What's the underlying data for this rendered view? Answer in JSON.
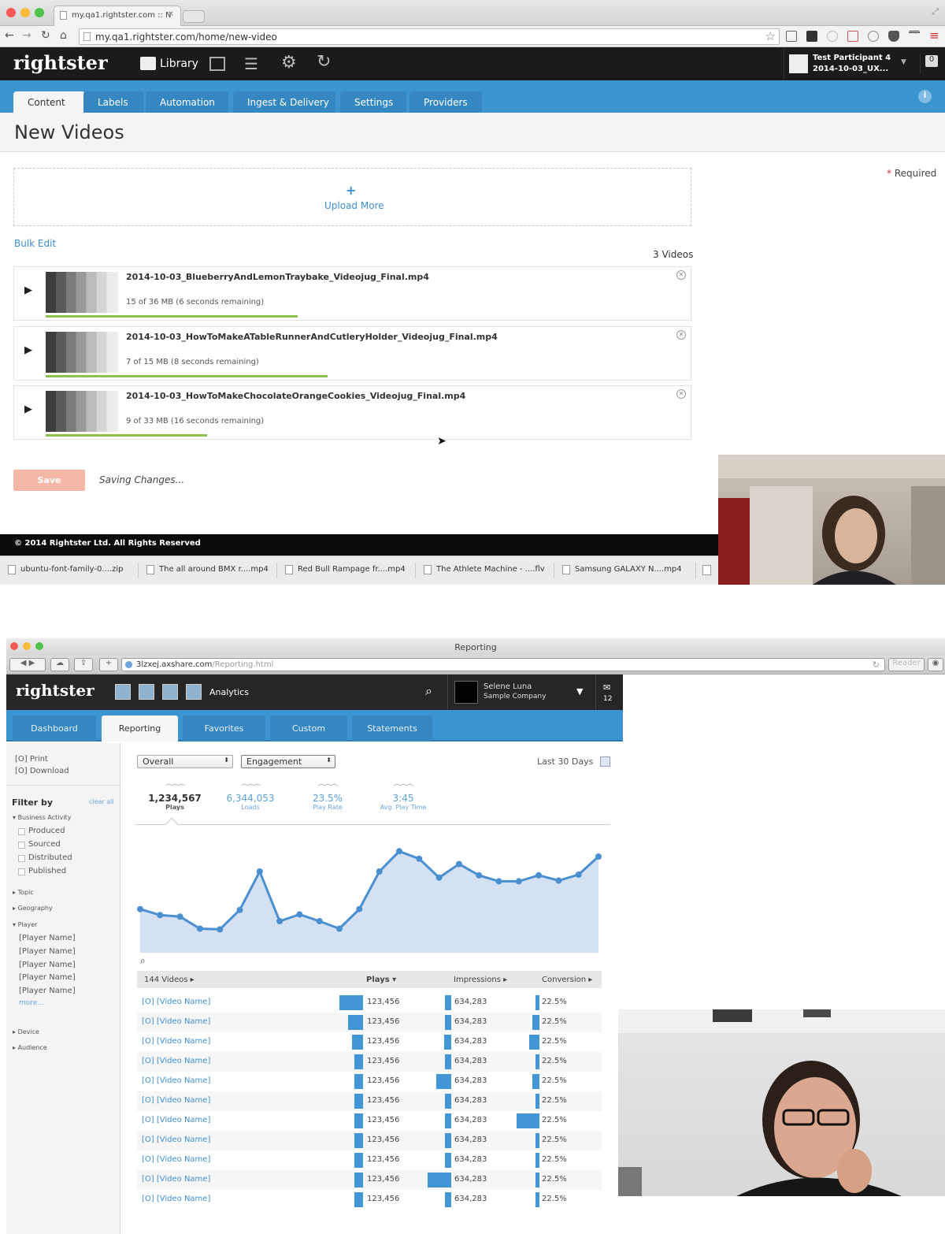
{
  "top_session": {
    "browser": {
      "tab_title": "my.qa1.rightster.com :: N",
      "url": "my.qa1.rightster.com/home/new-video"
    },
    "app": {
      "logo": "rightster",
      "library_label": "Library",
      "user_name": "Test Participant 4",
      "user_sub": "2014-10-03_UX...",
      "notif_count": "0",
      "tabs": [
        "Content",
        "Labels",
        "Automation",
        "Ingest & Delivery",
        "Settings",
        "Providers"
      ],
      "active_tab": "Content"
    },
    "page": {
      "title": "New Videos",
      "required_note": "Required",
      "upload_more": "Upload More",
      "bulk_edit": "Bulk Edit",
      "video_count": "3 Videos",
      "videos": [
        {
          "name": "2014-10-03_BlueberryAndLemonTraybake_Videojug_Final.mp4",
          "progress_text": "15 of 36 MB (6 seconds remaining)",
          "progress": 0.42
        },
        {
          "name": "2014-10-03_HowToMakeATableRunnerAndCutleryHolder_Videojug_Final.mp4",
          "progress_text": "7 of 15 MB (8 seconds remaining)",
          "progress": 0.47
        },
        {
          "name": "2014-10-03_HowToMakeChocolateOrangeCookies_Videojug_Final.mp4",
          "progress_text": "9 of 33 MB (16 seconds remaining)",
          "progress": 0.27
        }
      ],
      "save_label": "Save",
      "saving_text": "Saving Changes...",
      "footer": "© 2014 Rightster Ltd. All Rights Reserved"
    },
    "downloads": [
      "ubuntu-font-family-0....zip",
      "The all around BMX r....mp4",
      "Red Bull Rampage fr....mp4",
      "The Athlete Machine - ....flv",
      "Samsung GALAXY N....mp4"
    ]
  },
  "bottom_session": {
    "window_title": "Reporting",
    "url_host": "3lzxej.axshare.com",
    "url_path": "/Reporting.html",
    "reader_label": "Reader",
    "app": {
      "logo": "rightster",
      "section": "Analytics",
      "user_name": "Selene Luna",
      "company": "Sample Company",
      "msg_count": "12",
      "tabs": [
        "Dashboard",
        "Reporting",
        "Favorites",
        "Custom",
        "Statements"
      ],
      "active_tab": "Reporting"
    },
    "sidebar": {
      "print": "[O] Print",
      "download": "[O] Download",
      "filter_by": "Filter by",
      "clear_all": "clear all",
      "business_activity": "Business Activity",
      "business_items": [
        "Produced",
        "Sourced",
        "Distributed",
        "Published"
      ],
      "topic": "Topic",
      "geography": "Geography",
      "player": "Player",
      "player_items": [
        "[Player Name]",
        "[Player Name]",
        "[Player Name]",
        "[Player Name]",
        "[Player Name]"
      ],
      "more": "more...",
      "device": "Device",
      "audience": "Audience"
    },
    "controls": {
      "scope": "Overall",
      "metric": "Engagement",
      "range": "Last 30 Days"
    },
    "metrics": [
      {
        "value": "1,234,567",
        "label": "Plays"
      },
      {
        "value": "6,344,053",
        "label": "Loads"
      },
      {
        "value": "23.5%",
        "label": "Play Rate"
      },
      {
        "value": "3:45",
        "label": "Avg. Play Time"
      }
    ],
    "chart_data": {
      "type": "area",
      "title": "",
      "values": [
        58,
        50,
        48,
        32,
        31,
        57,
        108,
        42,
        51,
        42,
        32,
        58,
        108,
        135,
        125,
        100,
        118,
        103,
        95,
        95,
        103,
        96,
        104,
        128
      ],
      "ylim": [
        0,
        150
      ],
      "grid": false,
      "color": "#4a8fd0",
      "fill": "#d3e1f2"
    },
    "table": {
      "headers": [
        "144 Videos ▸",
        "Plays ▾",
        "Impressions ▸",
        "Conversion ▸"
      ],
      "rows": [
        {
          "name": "[O] [Video Name]",
          "plays": "123,456",
          "plays_bar": 1.0,
          "impr": "634,283",
          "impr_bar": 0.25,
          "conv": "22.5%",
          "conv_bar": 0.15
        },
        {
          "name": "[O] [Video Name]",
          "plays": "123,456",
          "plays_bar": 0.62,
          "impr": "634,283",
          "impr_bar": 0.25,
          "conv": "22.5%",
          "conv_bar": 0.3
        },
        {
          "name": "[O] [Video Name]",
          "plays": "123,456",
          "plays_bar": 0.45,
          "impr": "634,283",
          "impr_bar": 0.3,
          "conv": "22.5%",
          "conv_bar": 0.42
        },
        {
          "name": "[O] [Video Name]",
          "plays": "123,456",
          "plays_bar": 0.35,
          "impr": "634,283",
          "impr_bar": 0.25,
          "conv": "22.5%",
          "conv_bar": 0.15
        },
        {
          "name": "[O] [Video Name]",
          "plays": "123,456",
          "plays_bar": 0.35,
          "impr": "634,283",
          "impr_bar": 0.62,
          "conv": "22.5%",
          "conv_bar": 0.3
        },
        {
          "name": "[O] [Video Name]",
          "plays": "123,456",
          "plays_bar": 0.35,
          "impr": "634,283",
          "impr_bar": 0.25,
          "conv": "22.5%",
          "conv_bar": 0.15
        },
        {
          "name": "[O] [Video Name]",
          "plays": "123,456",
          "plays_bar": 0.35,
          "impr": "634,283",
          "impr_bar": 0.25,
          "conv": "22.5%",
          "conv_bar": 0.95
        },
        {
          "name": "[O] [Video Name]",
          "plays": "123,456",
          "plays_bar": 0.35,
          "impr": "634,283",
          "impr_bar": 0.25,
          "conv": "22.5%",
          "conv_bar": 0.15
        },
        {
          "name": "[O] [Video Name]",
          "plays": "123,456",
          "plays_bar": 0.35,
          "impr": "634,283",
          "impr_bar": 0.25,
          "conv": "22.5%",
          "conv_bar": 0.15
        },
        {
          "name": "[O] [Video Name]",
          "plays": "123,456",
          "plays_bar": 0.35,
          "impr": "634,283",
          "impr_bar": 1.0,
          "conv": "22.5%",
          "conv_bar": 0.15
        },
        {
          "name": "[O] [Video Name]",
          "plays": "123,456",
          "plays_bar": 0.35,
          "impr": "634,283",
          "impr_bar": 0.25,
          "conv": "22.5%",
          "conv_bar": 0.15
        }
      ]
    }
  },
  "colors": {
    "brand_blue": "#3d95d0",
    "dark_header": "#1b1b1b",
    "progress_green": "#8cc14c",
    "save_disabled": "#f5b7a6",
    "link_blue": "#3d8fd0"
  },
  "icons": [
    "file-icon",
    "back-icon",
    "forward-icon",
    "reload-icon",
    "home-icon",
    "star-icon",
    "library-icon",
    "export-icon",
    "sort-icon",
    "gear-icon",
    "refresh-icon",
    "info-icon",
    "plus-icon",
    "play-icon",
    "close-icon",
    "search-icon",
    "calendar-icon",
    "mail-icon",
    "chevron-down-icon",
    "cursor-icon"
  ]
}
